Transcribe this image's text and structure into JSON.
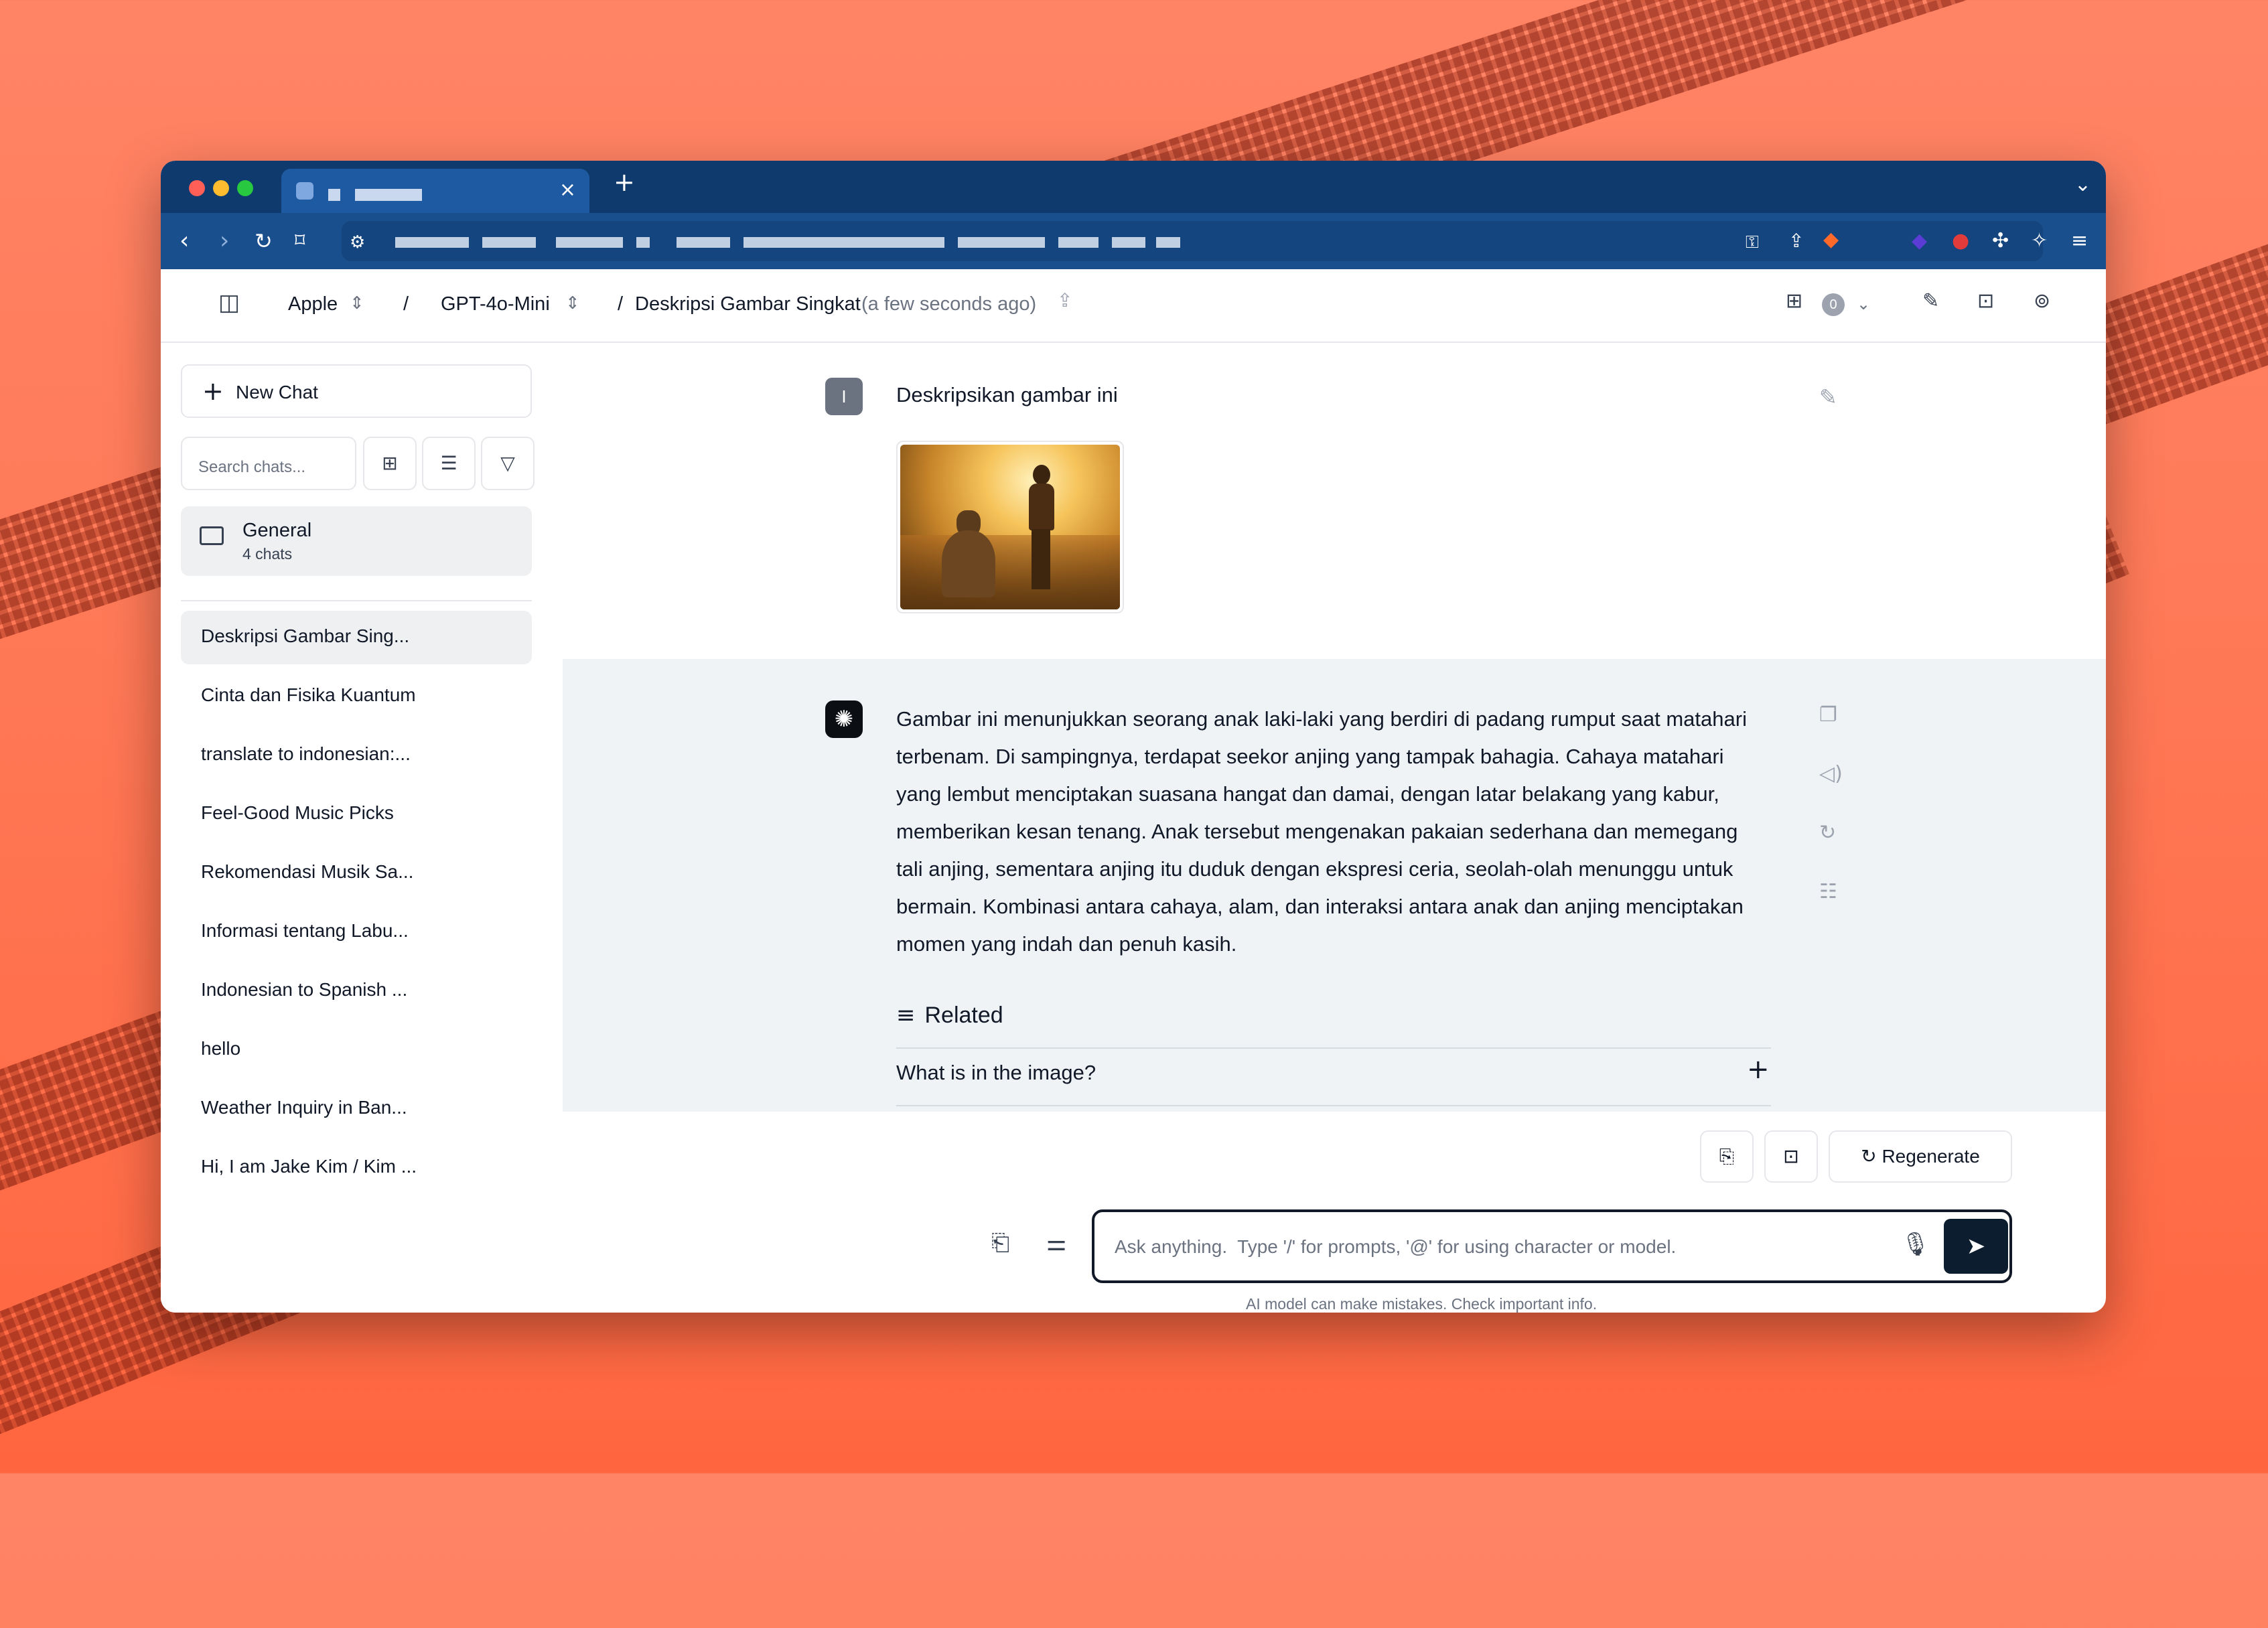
{
  "browser": {
    "new_tab_symbol": "+",
    "tab_close_symbol": "×"
  },
  "header": {
    "sidebar_toggle_icon": "sidebar-icon",
    "workspace": "Apple",
    "separator1": "/",
    "model": "GPT-4o-Mini",
    "separator2": "/",
    "chat_title": "Deskripsi Gambar Singkat",
    "timestamp": "(a few seconds ago)",
    "badge_count": "0"
  },
  "sidebar": {
    "new_chat_label": "New Chat",
    "search_placeholder": "Search chats...",
    "folder": {
      "name": "General",
      "count": "4 chats"
    },
    "chats": [
      "Deskripsi Gambar Sing...",
      "Cinta dan Fisika Kuantum",
      "translate to indonesian:...",
      "Feel-Good Music Picks",
      "Rekomendasi Musik Sa...",
      "Informasi tentang Labu...",
      "Indonesian to Spanish ...",
      "hello",
      "Weather Inquiry in Ban...",
      "Hi, I am Jake Kim / Kim ..."
    ]
  },
  "conversation": {
    "user_avatar_letter": "I",
    "user_prompt": "Deskripsikan gambar ini",
    "assistant_response": "Gambar ini menunjukkan seorang anak laki-laki yang berdiri di padang rumput saat matahari terbenam. Di sampingnya, terdapat seekor anjing yang tampak bahagia. Cahaya matahari yang lembut menciptakan suasana hangat dan damai, dengan latar belakang yang kabur, memberikan kesan tenang. Anak tersebut mengenakan pakaian sederhana dan memegang tali anjing, sementara anjing itu duduk dengan ekspresi ceria, seolah-olah menunggu untuk bermain. Kombinasi antara cahaya, alam, dan interaksi antara anak dan anjing menciptakan momen yang indah dan penuh kasih.",
    "related_heading": "Related",
    "related_question": "What is in the image?"
  },
  "composer": {
    "regenerate_label": "Regenerate",
    "placeholder": "Ask anything.  Type '/' for prompts, '@' for using character or model.",
    "value": "",
    "disclaimer": "AI model can make mistakes. Check important info."
  },
  "colors": {
    "chrome_tabbar": "#0f3a6d",
    "chrome_navbar": "#1a4f8e",
    "assistant_bg": "#eff3f6",
    "send_button": "#0b1d2e",
    "background": "#ff7a58"
  }
}
